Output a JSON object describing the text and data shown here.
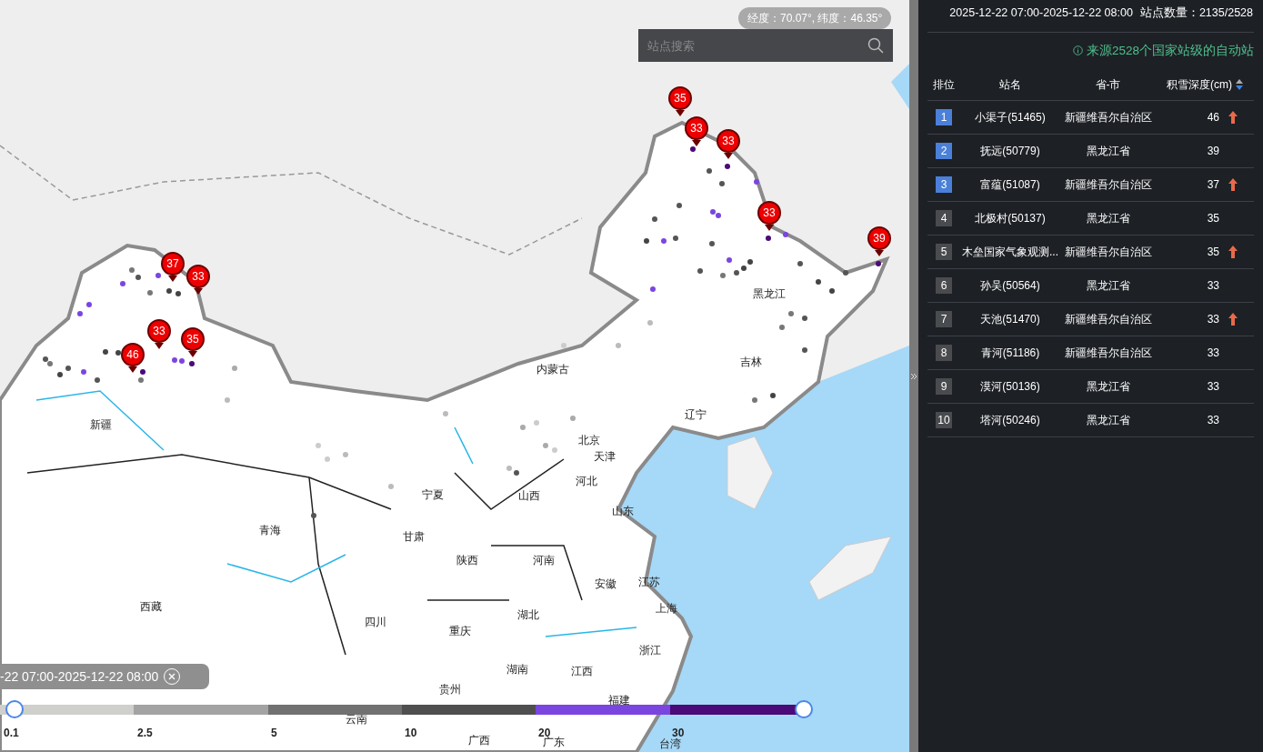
{
  "map": {
    "coordinates": "经度：70.07°, 纬度：46.35°",
    "search": {
      "placeholder": "站点搜索"
    },
    "regions": [
      {
        "label": "黑龙江"
      },
      {
        "label": "吉林"
      },
      {
        "label": "内蒙古"
      },
      {
        "label": "辽宁"
      },
      {
        "label": "新疆"
      },
      {
        "label": "北京"
      },
      {
        "label": "天津"
      },
      {
        "label": "河北"
      },
      {
        "label": "宁夏"
      },
      {
        "label": "山西"
      },
      {
        "label": "山东"
      },
      {
        "label": "青海"
      },
      {
        "label": "甘肃"
      },
      {
        "label": "陕西"
      },
      {
        "label": "河南"
      },
      {
        "label": "安徽"
      },
      {
        "label": "江苏"
      },
      {
        "label": "西藏"
      },
      {
        "label": "上海"
      },
      {
        "label": "湖北"
      },
      {
        "label": "四川"
      },
      {
        "label": "重庆"
      },
      {
        "label": "浙江"
      },
      {
        "label": "湖南"
      },
      {
        "label": "江西"
      },
      {
        "label": "贵州"
      },
      {
        "label": "福建"
      },
      {
        "label": "云南"
      },
      {
        "label": "广西"
      },
      {
        "label": "广东"
      },
      {
        "label": "台湾"
      }
    ],
    "markers": [
      {
        "value": "35"
      },
      {
        "value": "33"
      },
      {
        "value": "33"
      },
      {
        "value": "33"
      },
      {
        "value": "39"
      },
      {
        "value": "37"
      },
      {
        "value": "33"
      },
      {
        "value": "33"
      },
      {
        "value": "35"
      },
      {
        "value": "46"
      }
    ],
    "time_chip": {
      "text": "-22 07:00-2025-12-22 08:00"
    },
    "legend": {
      "ticks": [
        "0.1",
        "2.5",
        "5",
        "10",
        "20",
        "30"
      ],
      "segments": [
        {
          "color": "#cfcfcc"
        },
        {
          "color": "#a3a3a3"
        },
        {
          "color": "#717171"
        },
        {
          "color": "#4f4f4f"
        },
        {
          "color": "#7b45e0"
        },
        {
          "color": "#4b0a78"
        }
      ]
    }
  },
  "panel": {
    "period": "2025-12-22 07:00-2025-12-22 08:00",
    "station_count": "站点数量：2135/2528",
    "source_note": "来源2528个国家站级的自动站",
    "columns": [
      "排位",
      "站名",
      "省-市",
      "积雪深度(cm)"
    ],
    "rows": [
      {
        "rank": "1",
        "top": true,
        "name": "小渠子(51465)",
        "province": "新疆维吾尔自治区",
        "depth": "46",
        "rising": true
      },
      {
        "rank": "2",
        "top": true,
        "name": "抚远(50779)",
        "province": "黑龙江省",
        "depth": "39",
        "rising": false
      },
      {
        "rank": "3",
        "top": true,
        "name": "富蕴(51087)",
        "province": "新疆维吾尔自治区",
        "depth": "37",
        "rising": true
      },
      {
        "rank": "4",
        "top": false,
        "name": "北极村(50137)",
        "province": "黑龙江省",
        "depth": "35",
        "rising": false
      },
      {
        "rank": "5",
        "top": false,
        "name": "木垒国家气象观测...",
        "province": "新疆维吾尔自治区",
        "depth": "35",
        "rising": true
      },
      {
        "rank": "6",
        "top": false,
        "name": "孙吴(50564)",
        "province": "黑龙江省",
        "depth": "33",
        "rising": false
      },
      {
        "rank": "7",
        "top": false,
        "name": "天池(51470)",
        "province": "新疆维吾尔自治区",
        "depth": "33",
        "rising": true
      },
      {
        "rank": "8",
        "top": false,
        "name": "青河(51186)",
        "province": "新疆维吾尔自治区",
        "depth": "33",
        "rising": false
      },
      {
        "rank": "9",
        "top": false,
        "name": "漠河(50136)",
        "province": "黑龙江省",
        "depth": "33",
        "rising": false
      },
      {
        "rank": "10",
        "top": false,
        "name": "塔河(50246)",
        "province": "黑龙江省",
        "depth": "33",
        "rising": false
      }
    ]
  }
}
